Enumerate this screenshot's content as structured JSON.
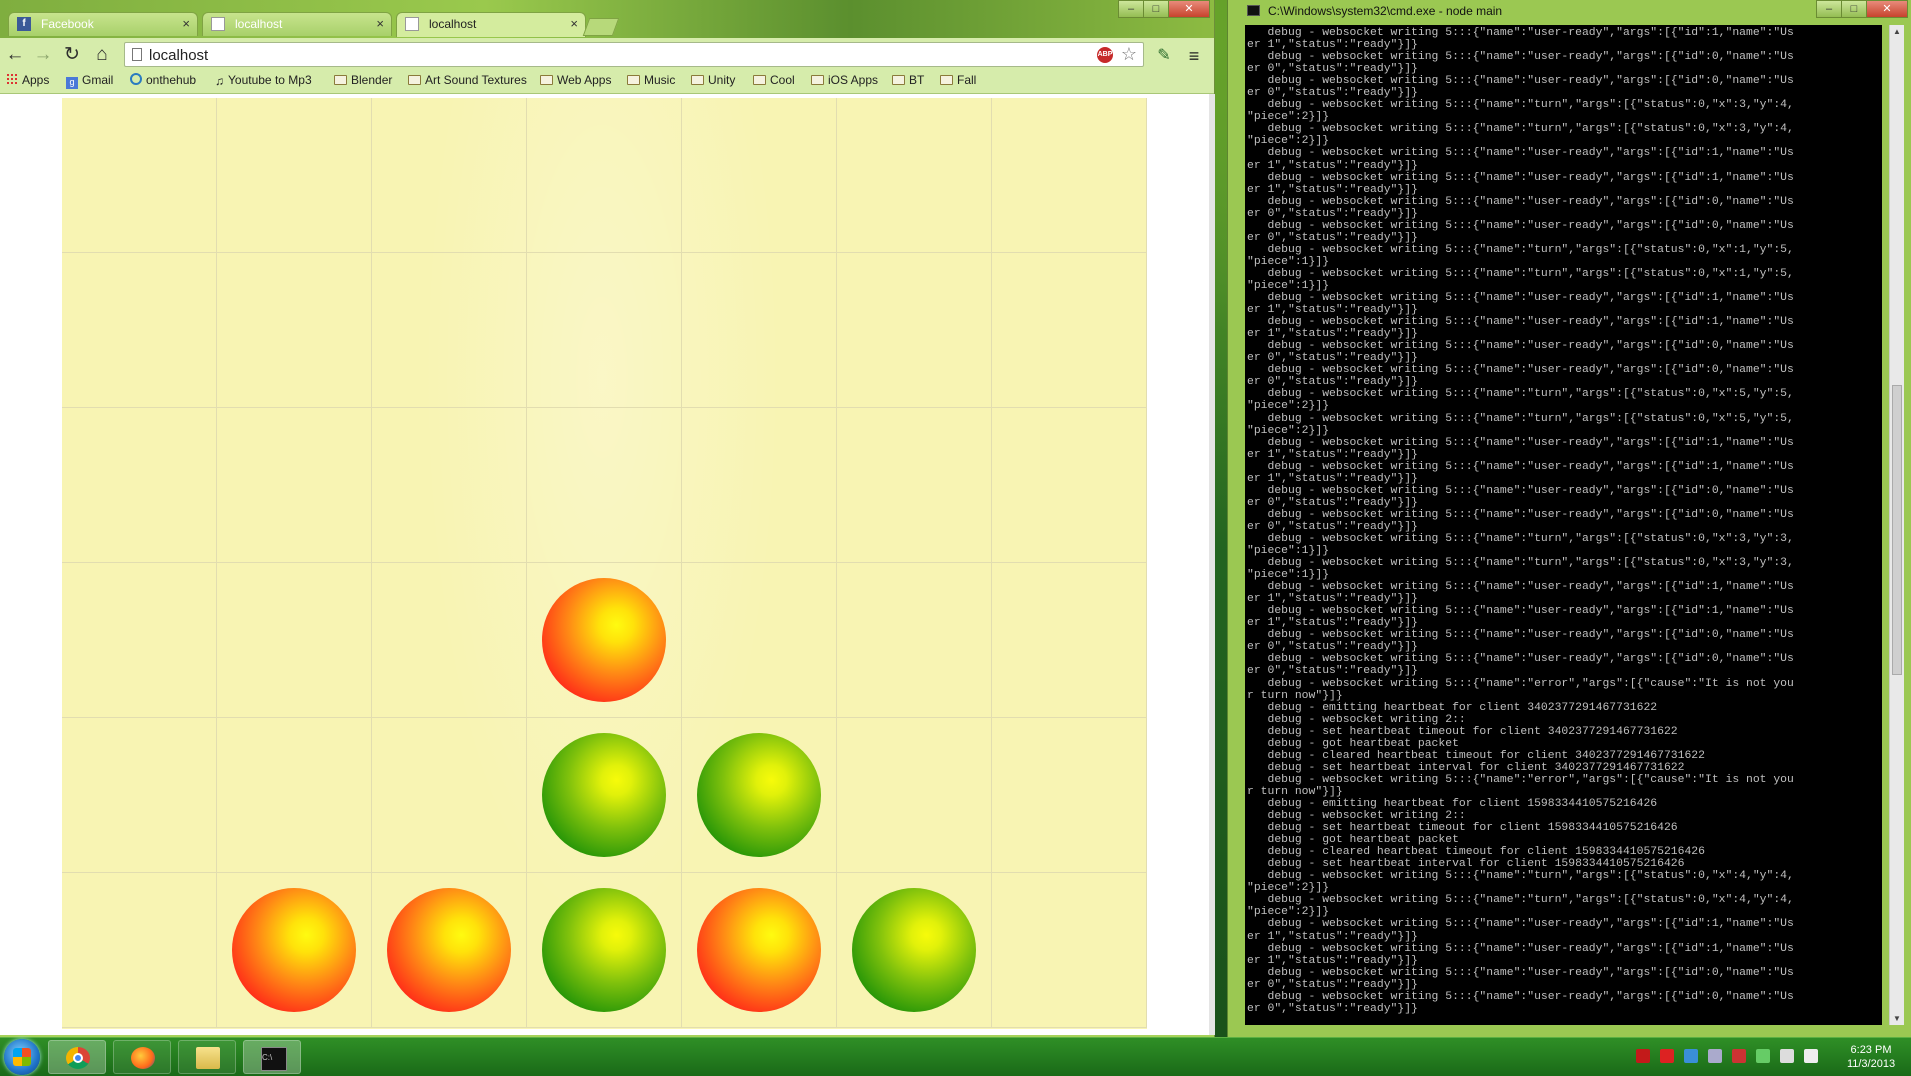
{
  "browser": {
    "tabs": [
      {
        "label": "Facebook",
        "icon": "facebook-icon"
      },
      {
        "label": "localhost",
        "icon": "page-icon"
      },
      {
        "label": "localhost",
        "icon": "page-icon",
        "active": true
      }
    ],
    "url": "localhost",
    "abp_label": "ABP",
    "bookmarks": [
      {
        "label": "Apps",
        "icon": "apps-icon"
      },
      {
        "label": "Gmail",
        "icon": "google-icon"
      },
      {
        "label": "onthehub",
        "icon": "onthehub-icon"
      },
      {
        "label": "Youtube to Mp3",
        "icon": "music-note-icon"
      },
      {
        "label": "Blender",
        "icon": "folder-icon"
      },
      {
        "label": "Art Sound Textures",
        "icon": "folder-icon"
      },
      {
        "label": "Web Apps",
        "icon": "folder-icon"
      },
      {
        "label": "Music",
        "icon": "folder-icon"
      },
      {
        "label": "Unity",
        "icon": "folder-icon"
      },
      {
        "label": "Cool",
        "icon": "folder-icon"
      },
      {
        "label": "iOS Apps",
        "icon": "folder-icon"
      },
      {
        "label": "BT",
        "icon": "folder-icon"
      },
      {
        "label": "Fall",
        "icon": "folder-icon"
      }
    ]
  },
  "game": {
    "columns": 7,
    "rows": 6,
    "colors": {
      "board": "#f8f4b3",
      "red": "#ff2a18",
      "green": "#2b9808"
    },
    "pieces": [
      {
        "col": 3,
        "row": 3,
        "color": "red"
      },
      {
        "col": 3,
        "row": 4,
        "color": "green"
      },
      {
        "col": 4,
        "row": 4,
        "color": "green"
      },
      {
        "col": 1,
        "row": 5,
        "color": "red"
      },
      {
        "col": 2,
        "row": 5,
        "color": "red"
      },
      {
        "col": 3,
        "row": 5,
        "color": "green"
      },
      {
        "col": 4,
        "row": 5,
        "color": "red"
      },
      {
        "col": 5,
        "row": 5,
        "color": "green"
      }
    ]
  },
  "console": {
    "title": "C:\\Windows\\system32\\cmd.exe - node  main",
    "lines": [
      "   debug - websocket writing 5:::{\"name\":\"user-ready\",\"args\":[{\"id\":1,\"name\":\"Us",
      "er 1\",\"status\":\"ready\"}]}",
      "   debug - websocket writing 5:::{\"name\":\"user-ready\",\"args\":[{\"id\":0,\"name\":\"Us",
      "er 0\",\"status\":\"ready\"}]}",
      "   debug - websocket writing 5:::{\"name\":\"user-ready\",\"args\":[{\"id\":0,\"name\":\"Us",
      "er 0\",\"status\":\"ready\"}]}",
      "   debug - websocket writing 5:::{\"name\":\"turn\",\"args\":[{\"status\":0,\"x\":3,\"y\":4,",
      "\"piece\":2}]}",
      "   debug - websocket writing 5:::{\"name\":\"turn\",\"args\":[{\"status\":0,\"x\":3,\"y\":4,",
      "\"piece\":2}]}",
      "   debug - websocket writing 5:::{\"name\":\"user-ready\",\"args\":[{\"id\":1,\"name\":\"Us",
      "er 1\",\"status\":\"ready\"}]}",
      "   debug - websocket writing 5:::{\"name\":\"user-ready\",\"args\":[{\"id\":1,\"name\":\"Us",
      "er 1\",\"status\":\"ready\"}]}",
      "   debug - websocket writing 5:::{\"name\":\"user-ready\",\"args\":[{\"id\":0,\"name\":\"Us",
      "er 0\",\"status\":\"ready\"}]}",
      "   debug - websocket writing 5:::{\"name\":\"user-ready\",\"args\":[{\"id\":0,\"name\":\"Us",
      "er 0\",\"status\":\"ready\"}]}",
      "   debug - websocket writing 5:::{\"name\":\"turn\",\"args\":[{\"status\":0,\"x\":1,\"y\":5,",
      "\"piece\":1}]}",
      "   debug - websocket writing 5:::{\"name\":\"turn\",\"args\":[{\"status\":0,\"x\":1,\"y\":5,",
      "\"piece\":1}]}",
      "   debug - websocket writing 5:::{\"name\":\"user-ready\",\"args\":[{\"id\":1,\"name\":\"Us",
      "er 1\",\"status\":\"ready\"}]}",
      "   debug - websocket writing 5:::{\"name\":\"user-ready\",\"args\":[{\"id\":1,\"name\":\"Us",
      "er 1\",\"status\":\"ready\"}]}",
      "   debug - websocket writing 5:::{\"name\":\"user-ready\",\"args\":[{\"id\":0,\"name\":\"Us",
      "er 0\",\"status\":\"ready\"}]}",
      "   debug - websocket writing 5:::{\"name\":\"user-ready\",\"args\":[{\"id\":0,\"name\":\"Us",
      "er 0\",\"status\":\"ready\"}]}",
      "   debug - websocket writing 5:::{\"name\":\"turn\",\"args\":[{\"status\":0,\"x\":5,\"y\":5,",
      "\"piece\":2}]}",
      "   debug - websocket writing 5:::{\"name\":\"turn\",\"args\":[{\"status\":0,\"x\":5,\"y\":5,",
      "\"piece\":2}]}",
      "   debug - websocket writing 5:::{\"name\":\"user-ready\",\"args\":[{\"id\":1,\"name\":\"Us",
      "er 1\",\"status\":\"ready\"}]}",
      "   debug - websocket writing 5:::{\"name\":\"user-ready\",\"args\":[{\"id\":1,\"name\":\"Us",
      "er 1\",\"status\":\"ready\"}]}",
      "   debug - websocket writing 5:::{\"name\":\"user-ready\",\"args\":[{\"id\":0,\"name\":\"Us",
      "er 0\",\"status\":\"ready\"}]}",
      "   debug - websocket writing 5:::{\"name\":\"user-ready\",\"args\":[{\"id\":0,\"name\":\"Us",
      "er 0\",\"status\":\"ready\"}]}",
      "   debug - websocket writing 5:::{\"name\":\"turn\",\"args\":[{\"status\":0,\"x\":3,\"y\":3,",
      "\"piece\":1}]}",
      "   debug - websocket writing 5:::{\"name\":\"turn\",\"args\":[{\"status\":0,\"x\":3,\"y\":3,",
      "\"piece\":1}]}",
      "   debug - websocket writing 5:::{\"name\":\"user-ready\",\"args\":[{\"id\":1,\"name\":\"Us",
      "er 1\",\"status\":\"ready\"}]}",
      "   debug - websocket writing 5:::{\"name\":\"user-ready\",\"args\":[{\"id\":1,\"name\":\"Us",
      "er 1\",\"status\":\"ready\"}]}",
      "   debug - websocket writing 5:::{\"name\":\"user-ready\",\"args\":[{\"id\":0,\"name\":\"Us",
      "er 0\",\"status\":\"ready\"}]}",
      "   debug - websocket writing 5:::{\"name\":\"user-ready\",\"args\":[{\"id\":0,\"name\":\"Us",
      "er 0\",\"status\":\"ready\"}]}",
      "   debug - websocket writing 5:::{\"name\":\"error\",\"args\":[{\"cause\":\"It is not you",
      "r turn now\"}]}",
      "   debug - emitting heartbeat for client 3402377291467731622",
      "   debug - websocket writing 2::",
      "   debug - set heartbeat timeout for client 3402377291467731622",
      "   debug - got heartbeat packet",
      "   debug - cleared heartbeat timeout for client 3402377291467731622",
      "   debug - set heartbeat interval for client 3402377291467731622",
      "   debug - websocket writing 5:::{\"name\":\"error\",\"args\":[{\"cause\":\"It is not you",
      "r turn now\"}]}",
      "   debug - emitting heartbeat for client 1598334410575216426",
      "   debug - websocket writing 2::",
      "   debug - set heartbeat timeout for client 1598334410575216426",
      "   debug - got heartbeat packet",
      "   debug - cleared heartbeat timeout for client 1598334410575216426",
      "   debug - set heartbeat interval for client 1598334410575216426",
      "   debug - websocket writing 5:::{\"name\":\"turn\",\"args\":[{\"status\":0,\"x\":4,\"y\":4,",
      "\"piece\":2}]}",
      "   debug - websocket writing 5:::{\"name\":\"turn\",\"args\":[{\"status\":0,\"x\":4,\"y\":4,",
      "\"piece\":2}]}",
      "   debug - websocket writing 5:::{\"name\":\"user-ready\",\"args\":[{\"id\":1,\"name\":\"Us",
      "er 1\",\"status\":\"ready\"}]}",
      "   debug - websocket writing 5:::{\"name\":\"user-ready\",\"args\":[{\"id\":1,\"name\":\"Us",
      "er 1\",\"status\":\"ready\"}]}",
      "   debug - websocket writing 5:::{\"name\":\"user-ready\",\"args\":[{\"id\":0,\"name\":\"Us",
      "er 0\",\"status\":\"ready\"}]}",
      "   debug - websocket writing 5:::{\"name\":\"user-ready\",\"args\":[{\"id\":0,\"name\":\"Us",
      "er 0\",\"status\":\"ready\"}]}"
    ]
  },
  "taskbar": {
    "apps": [
      {
        "name": "chrome",
        "icon": "chrome-icon",
        "active": true
      },
      {
        "name": "firefox",
        "icon": "firefox-icon"
      },
      {
        "name": "explorer",
        "icon": "folder-icon"
      },
      {
        "name": "cmd",
        "icon": "cmd-icon",
        "active": true
      }
    ],
    "time": "6:23 PM",
    "date": "11/3/2013"
  }
}
